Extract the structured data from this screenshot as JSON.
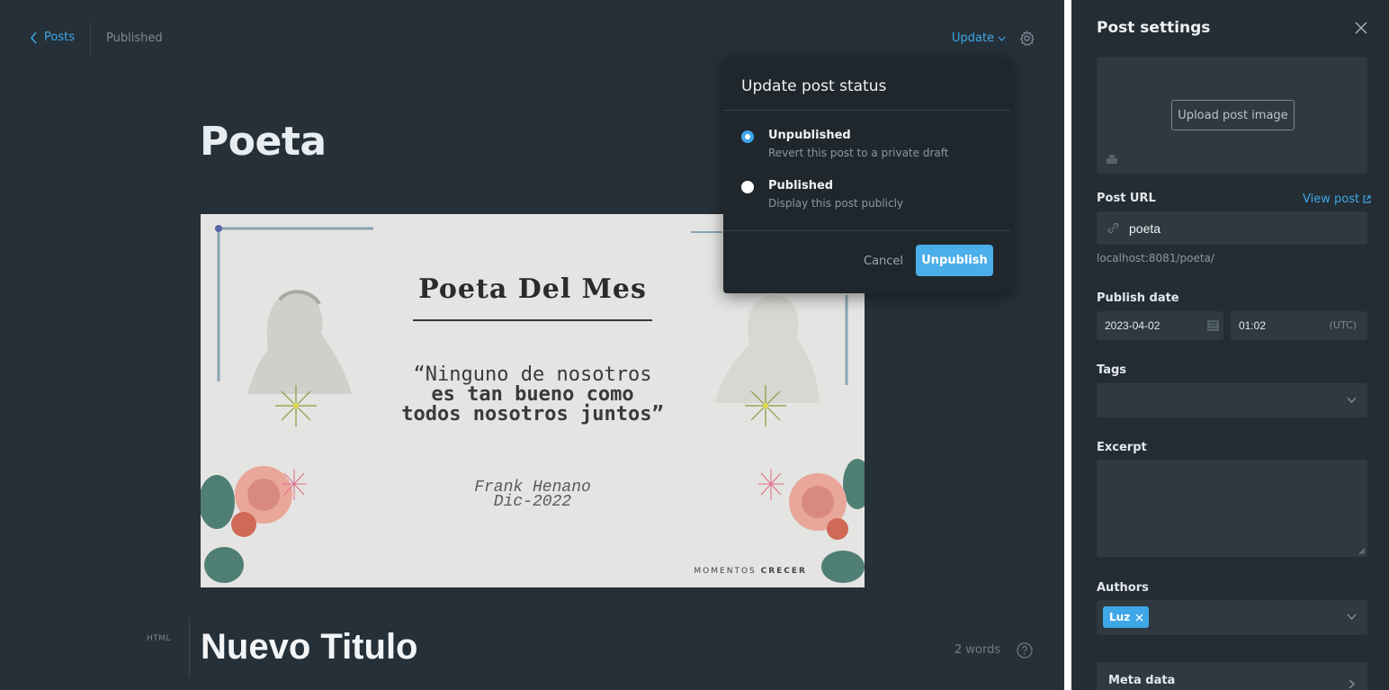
{
  "header": {
    "back_label": "Posts",
    "status": "Published",
    "update_label": "Update"
  },
  "post": {
    "title": "Poeta",
    "subtitle": "Nuevo Titulo",
    "card_label": "HTML",
    "word_count": "2 words"
  },
  "feature_image": {
    "title": "Poeta Del Mes",
    "quote_line1": "“Ninguno de nosotros",
    "quote_line2": "es tan bueno como",
    "quote_line3": "todos nosotros juntos”",
    "author": "Frank Henano",
    "date": "Dic-2022",
    "brand_left": "MOMENTOS",
    "brand_right": "CRECER"
  },
  "popup": {
    "title": "Update post status",
    "options": [
      {
        "label": "Unpublished",
        "desc": "Revert this post to a private draft",
        "selected": true
      },
      {
        "label": "Published",
        "desc": "Display this post publicly",
        "selected": false
      }
    ],
    "cancel_label": "Cancel",
    "confirm_label": "Unpublish"
  },
  "sidebar": {
    "title": "Post settings",
    "upload_label": "Upload post image",
    "post_url_label": "Post URL",
    "view_post_label": "View post",
    "slug": "poeta",
    "url_hint": "localhost:8081/poeta/",
    "publish_date_label": "Publish date",
    "date": "2023-04-02",
    "time": "01:02",
    "timezone": "(UTC)",
    "tags_label": "Tags",
    "excerpt_label": "Excerpt",
    "authors_label": "Authors",
    "authors": [
      "Luz"
    ],
    "meta_label": "Meta data"
  },
  "colors": {
    "accent": "#3ea7e8",
    "editor_bg": "#263038",
    "sidebar_bg": "#242d34",
    "field_bg": "#2f393f"
  },
  "icons": [
    "chevron-left-icon",
    "chevron-down-icon",
    "gear-icon",
    "close-icon",
    "image-icon",
    "external-link-icon",
    "link-icon",
    "calendar-icon",
    "help-icon",
    "chevron-right-icon"
  ]
}
